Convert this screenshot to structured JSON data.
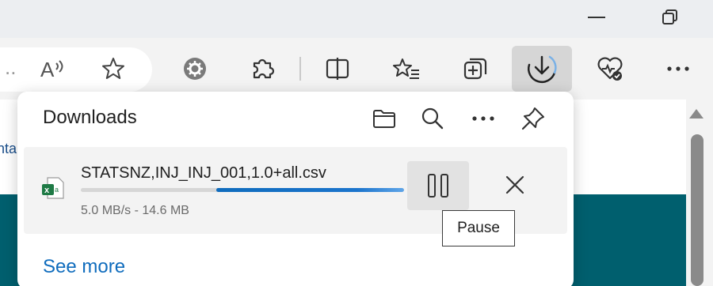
{
  "window": {
    "minimize_icon": "minimize-icon",
    "restore_icon": "restore-icon"
  },
  "toolbar": {
    "address_text": "..",
    "icons": [
      "read-aloud-icon",
      "favorite-star-icon",
      "extension-gear-icon",
      "extensions-puzzle-icon",
      "split-screen-icon",
      "favorites-icon",
      "collections-icon",
      "downloads-icon",
      "browser-essentials-icon",
      "more-icon"
    ]
  },
  "page": {
    "partial_text": "nta"
  },
  "downloads": {
    "title": "Downloads",
    "header_icons": [
      "open-folder-icon",
      "search-icon",
      "more-options-icon",
      "pin-icon"
    ],
    "item": {
      "file_name": "STATSNZ,INJ_INJ_001,1.0+all.csv",
      "meta": "5.0 MB/s - 14.6 MB",
      "progress": 0.5,
      "file_type_icon": "excel-file-icon"
    },
    "see_more": "See more",
    "tooltip": "Pause"
  },
  "colors": {
    "accent": "#0f6cbd",
    "page_teal": "#005f6e"
  }
}
